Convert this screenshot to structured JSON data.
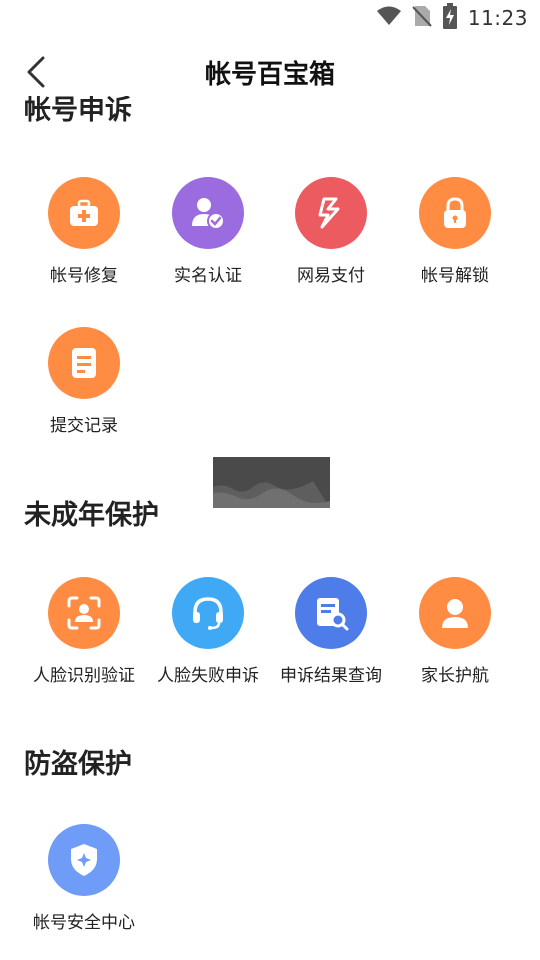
{
  "status_bar": {
    "time": "11:23"
  },
  "header": {
    "title": "帐号百宝箱"
  },
  "sections": [
    {
      "title": "帐号申诉",
      "items": [
        {
          "label": "帐号修复",
          "icon": "first-aid-kit-icon",
          "color": "#FF8C42"
        },
        {
          "label": "实名认证",
          "icon": "user-verified-icon",
          "color": "#9B6BE0"
        },
        {
          "label": "网易支付",
          "icon": "netease-pay-icon",
          "color": "#EC5B5F"
        },
        {
          "label": "帐号解锁",
          "icon": "lock-icon",
          "color": "#FF8C42"
        },
        {
          "label": "提交记录",
          "icon": "document-icon",
          "color": "#FF8C42"
        }
      ]
    },
    {
      "title": "未成年保护",
      "items": [
        {
          "label": "人脸识别验证",
          "icon": "face-scan-icon",
          "color": "#FF8C42"
        },
        {
          "label": "人脸失败申诉",
          "icon": "headset-icon",
          "color": "#3FA9F5"
        },
        {
          "label": "申诉结果查询",
          "icon": "search-document-icon",
          "color": "#4E7CE8"
        },
        {
          "label": "家长护航",
          "icon": "parent-user-icon",
          "color": "#FF8C42"
        }
      ]
    },
    {
      "title": "防盗保护",
      "items": [
        {
          "label": "帐号安全中心",
          "icon": "shield-icon",
          "color": "#6E9CF7"
        }
      ]
    }
  ]
}
